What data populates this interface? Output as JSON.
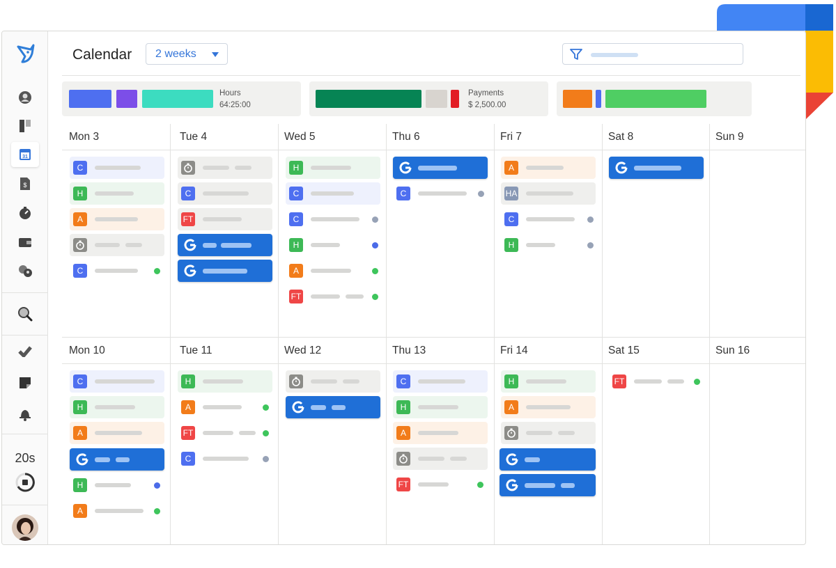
{
  "header": {
    "title": "Calendar",
    "range_select": "2 weeks"
  },
  "summary": {
    "hours": {
      "label": "Hours",
      "value": "64:25:00"
    },
    "payments": {
      "label": "Payments",
      "value": "$ 2,500.00"
    }
  },
  "colors": {
    "brand": "#3475d9",
    "client": "#4e6ff0",
    "holiday": "#3db956",
    "absence": "#f27c1a",
    "fulltime": "#ef4646",
    "timer": "#8c8c88",
    "google": "#1f6fd7"
  },
  "icons": [
    "logo-icon",
    "profile-icon",
    "board-icon",
    "calendar-icon",
    "invoice-icon",
    "timer-icon",
    "wallet-icon",
    "team-icon",
    "search-icon",
    "tasks-icon",
    "notes-icon",
    "bell-icon",
    "stop-icon",
    "filter-icon",
    "google-icon",
    "google-calendar-icon"
  ],
  "calendar_badge": "31",
  "timer": {
    "label": "20s"
  },
  "days": {
    "w1": [
      "Mon 3",
      "Tue 4",
      "Wed 5",
      "Thu 6",
      "Fri 7",
      "Sat 8",
      "Sun 9"
    ],
    "w2": [
      "Mon 10",
      "Tue 11",
      "Wed 12",
      "Thu 13",
      "Fri 14",
      "Sat 15",
      "Sun 16"
    ]
  },
  "badges": {
    "c": "C",
    "h": "H",
    "a": "A",
    "ft": "FT",
    "ha": "HA"
  }
}
